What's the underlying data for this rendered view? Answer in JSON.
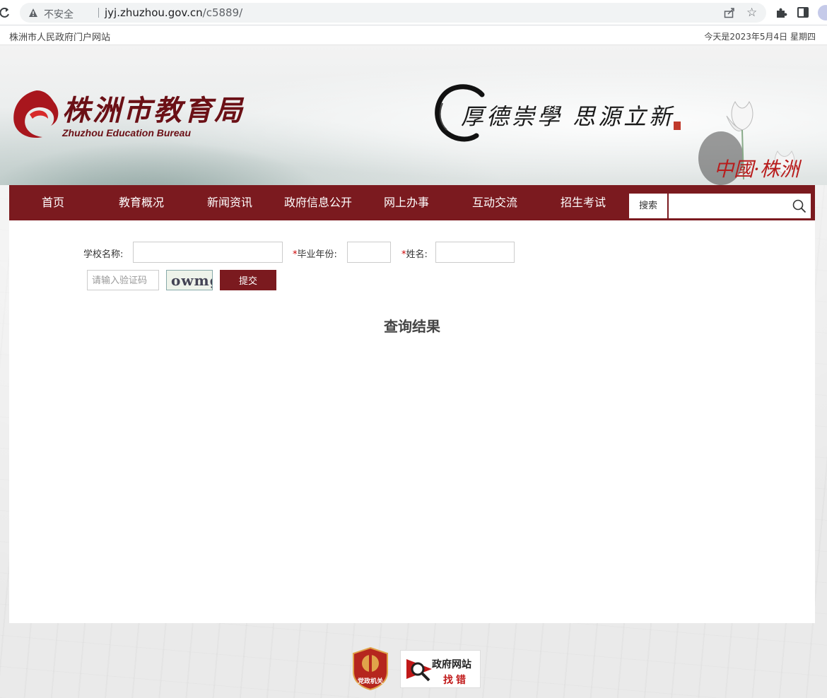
{
  "browser": {
    "security_label": "不安全",
    "url_host": "jyj.zhuzhou.gov.cn",
    "url_path": "/c5889/"
  },
  "topbar": {
    "portal_link": "株洲市人民政府门户网站",
    "date_text": "今天是2023年5月4日 星期四"
  },
  "banner": {
    "logo_cn": "株洲市教育局",
    "logo_en": "Zhuzhou Education Bureau",
    "motto": "厚德崇學 思源立新",
    "signature": "中國·株洲"
  },
  "nav": {
    "items": [
      "首页",
      "教育概况",
      "新闻资讯",
      "政府信息公开",
      "网上办事",
      "互动交流",
      "招生考试"
    ],
    "search_label": "搜索",
    "search_value": ""
  },
  "form": {
    "school_label": "学校名称:",
    "school_value": "",
    "year_label": "毕业年份:",
    "year_value": "",
    "name_label": "姓名:",
    "name_value": "",
    "required_mark": "*",
    "captcha_placeholder": "请输入验证码",
    "captcha_text": "owmg",
    "submit_label": "提交"
  },
  "results": {
    "title": "查询结果"
  },
  "footer": {
    "party_badge": "党政机关",
    "findbug_line1": "政府网站",
    "findbug_line2": "找错"
  },
  "colors": {
    "brand": "#7b1a1f",
    "required": "#cc0000",
    "findbug_red": "#c01818"
  }
}
